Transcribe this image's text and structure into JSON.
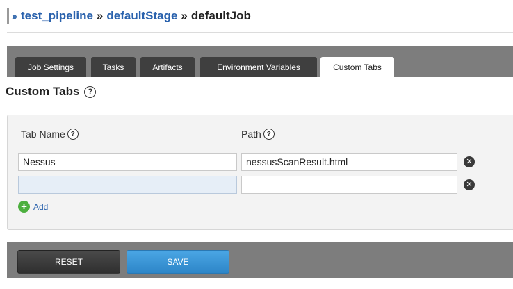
{
  "breadcrumb": {
    "marker": "›››",
    "items": [
      "test_pipeline",
      "defaultStage",
      "defaultJob"
    ],
    "separator": "»"
  },
  "tabs": [
    {
      "label": "Job Settings",
      "active": false
    },
    {
      "label": "Tasks",
      "active": false
    },
    {
      "label": "Artifacts",
      "active": false
    },
    {
      "label": "Environment Variables",
      "active": false
    },
    {
      "label": "Custom Tabs",
      "active": true
    }
  ],
  "section": {
    "title": "Custom Tabs",
    "help_icon": "question-circle-icon"
  },
  "form": {
    "columns": {
      "tab_name": "Tab Name",
      "path": "Path"
    },
    "rows": [
      {
        "tab_name": "Nessus",
        "path": "nessusScanResult.html"
      },
      {
        "tab_name": "",
        "path": ""
      }
    ],
    "add_label": "Add"
  },
  "actions": {
    "reset_label": "RESET",
    "save_label": "SAVE"
  },
  "colors": {
    "link": "#2a62ad",
    "tab_bar": "#7d7d7d",
    "tab_inactive": "#3f3f3f",
    "add_icon": "#4caf3e",
    "save_button": "#3b96d6",
    "reset_button": "#3a3a3a"
  }
}
